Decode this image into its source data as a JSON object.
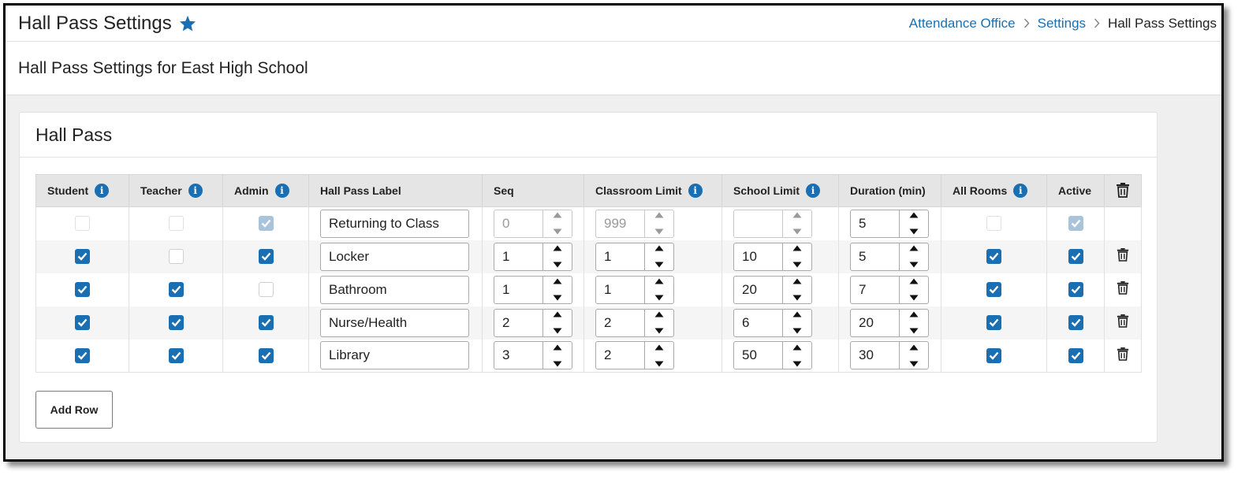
{
  "header": {
    "title": "Hall Pass Settings",
    "breadcrumb": [
      "Attendance Office",
      "Settings",
      "Hall Pass Settings"
    ]
  },
  "subheader": {
    "title": "Hall Pass Settings for East High School"
  },
  "card": {
    "title": "Hall Pass"
  },
  "table": {
    "columns": {
      "student": "Student",
      "teacher": "Teacher",
      "admin": "Admin",
      "label": "Hall Pass Label",
      "seq": "Seq",
      "classroom_limit": "Classroom Limit",
      "school_limit": "School Limit",
      "duration": "Duration (min)",
      "all_rooms": "All Rooms",
      "active": "Active"
    },
    "rows": [
      {
        "student": false,
        "teacher": false,
        "admin": true,
        "label": "Returning to Class",
        "seq": "0",
        "classroom_limit": "999",
        "school_limit": "",
        "duration": "5",
        "all_rooms": false,
        "active": true,
        "locked": true
      },
      {
        "student": true,
        "teacher": false,
        "admin": true,
        "label": "Locker",
        "seq": "1",
        "classroom_limit": "1",
        "school_limit": "10",
        "duration": "5",
        "all_rooms": true,
        "active": true,
        "locked": false
      },
      {
        "student": true,
        "teacher": true,
        "admin": false,
        "label": "Bathroom",
        "seq": "1",
        "classroom_limit": "1",
        "school_limit": "20",
        "duration": "7",
        "all_rooms": true,
        "active": true,
        "locked": false
      },
      {
        "student": true,
        "teacher": true,
        "admin": true,
        "label": "Nurse/Health",
        "seq": "2",
        "classroom_limit": "2",
        "school_limit": "6",
        "duration": "20",
        "all_rooms": true,
        "active": true,
        "locked": false
      },
      {
        "student": true,
        "teacher": true,
        "admin": true,
        "label": "Library",
        "seq": "3",
        "classroom_limit": "2",
        "school_limit": "50",
        "duration": "30",
        "all_rooms": true,
        "active": true,
        "locked": false
      }
    ]
  },
  "actions": {
    "add_row": "Add Row"
  },
  "icons": {
    "favorite": "star-icon",
    "info": "info-icon",
    "delete": "trash-icon",
    "breadcrumb_separator": "chevron-right-icon"
  },
  "colors": {
    "accent": "#1a6fb3",
    "header_bg": "#e5e5e5",
    "page_bg": "#efefef"
  }
}
